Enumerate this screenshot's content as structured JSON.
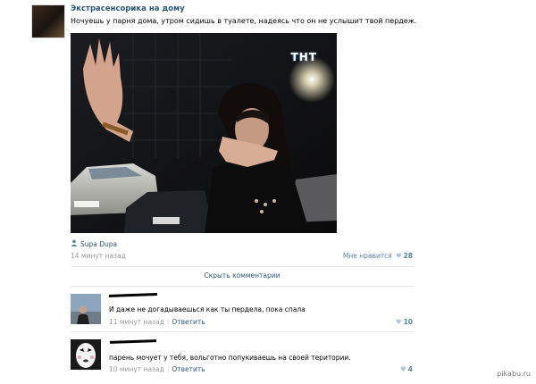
{
  "post": {
    "group_name": "Экстрасенсорика на дому",
    "text": "Ночуешь у парня дома, утром сидишь в туалете, надеясь что он не услышит твой пердеж.",
    "image_logo": "ТНТ",
    "author": "Supa Dupa",
    "author_icon": "user-icon",
    "time": "14 минут назад",
    "likes_label": "Мне нравится",
    "likes_count": "28"
  },
  "comments_toggle": "Скрыть комментарии",
  "comments": [
    {
      "text": "И даже не догадываешься как ты пердела, пока спала",
      "time": "11 минут назад",
      "reply_label": "Ответить",
      "likes": "10"
    },
    {
      "text": "парень мочует у тебя, вольготно попукиваешь на своей територии.",
      "time": "10 минут назад",
      "reply_label": "Ответить",
      "likes": "4"
    }
  ],
  "watermark": "pikabu.ru",
  "colors": {
    "link": "#2b587a",
    "muted": "#999999",
    "heart": "#aec3d6"
  }
}
